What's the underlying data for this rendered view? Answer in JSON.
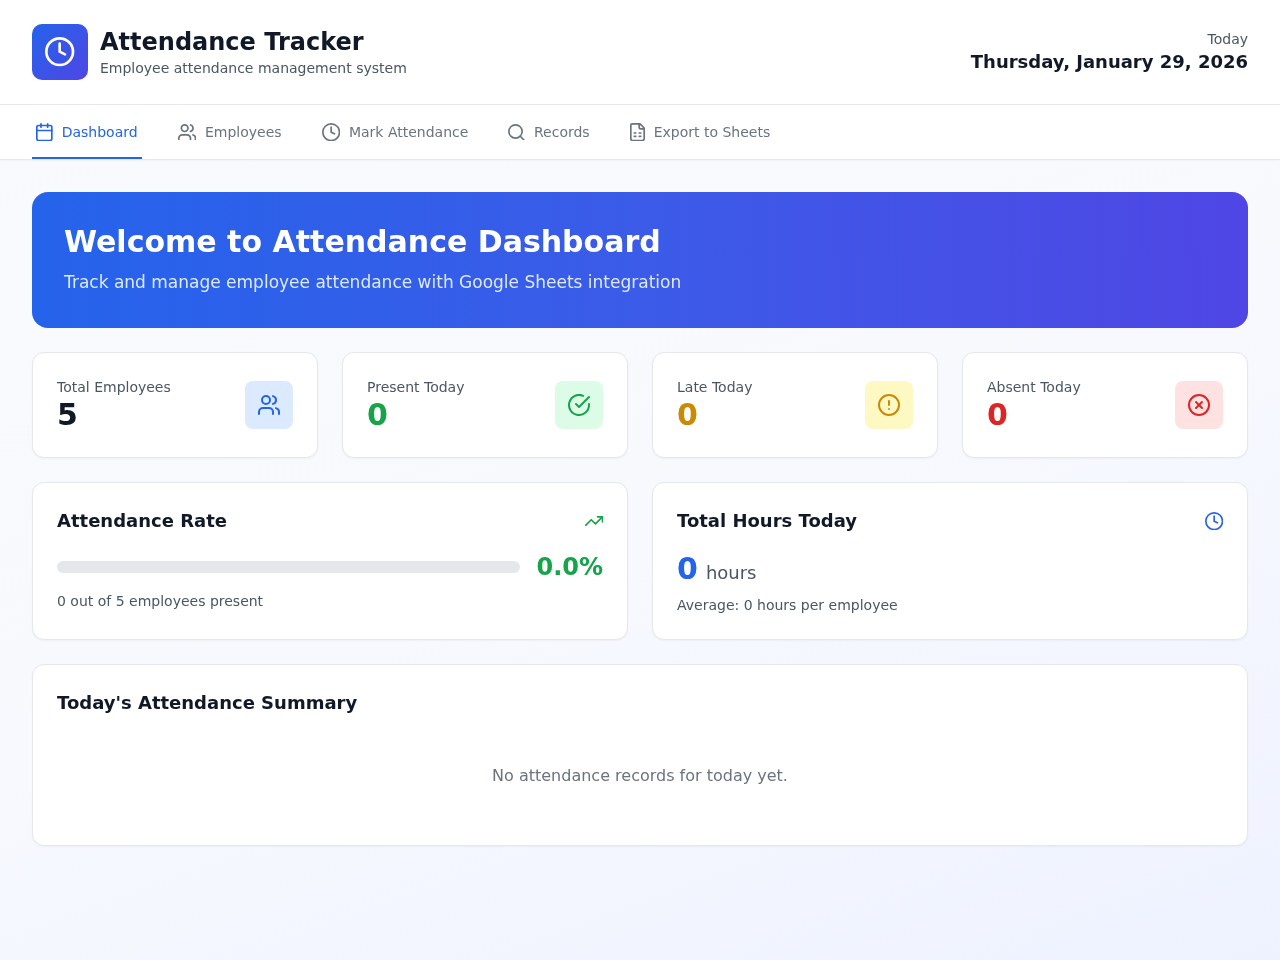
{
  "header": {
    "title": "Attendance Tracker",
    "subtitle": "Employee attendance management system",
    "date_label": "Today",
    "date": "Thursday, January 29, 2026"
  },
  "tabs": [
    {
      "label": "Dashboard",
      "selected": true
    },
    {
      "label": "Employees",
      "selected": false
    },
    {
      "label": "Mark Attendance",
      "selected": false
    },
    {
      "label": "Records",
      "selected": false
    },
    {
      "label": "Export to Sheets",
      "selected": false
    }
  ],
  "banner": {
    "title": "Welcome to Attendance Dashboard",
    "subtitle": "Track and manage employee attendance with Google Sheets integration"
  },
  "stats": [
    {
      "label": "Total Employees",
      "value": "5",
      "color": "#111827"
    },
    {
      "label": "Present Today",
      "value": "0",
      "color": "#16a34a"
    },
    {
      "label": "Late Today",
      "value": "0",
      "color": "#ca8a04"
    },
    {
      "label": "Absent Today",
      "value": "0",
      "color": "#dc2626"
    }
  ],
  "attendance_rate": {
    "title": "Attendance Rate",
    "reading": "0.0%",
    "caption": "0 out of 5 employees present"
  },
  "hours": {
    "title": "Total Hours Today",
    "value": "0",
    "unit": "hours",
    "caption": "Average: 0 hours per employee"
  },
  "summary": {
    "title": "Today's Attendance Summary",
    "empty_message": "No attendance records for today yet."
  }
}
